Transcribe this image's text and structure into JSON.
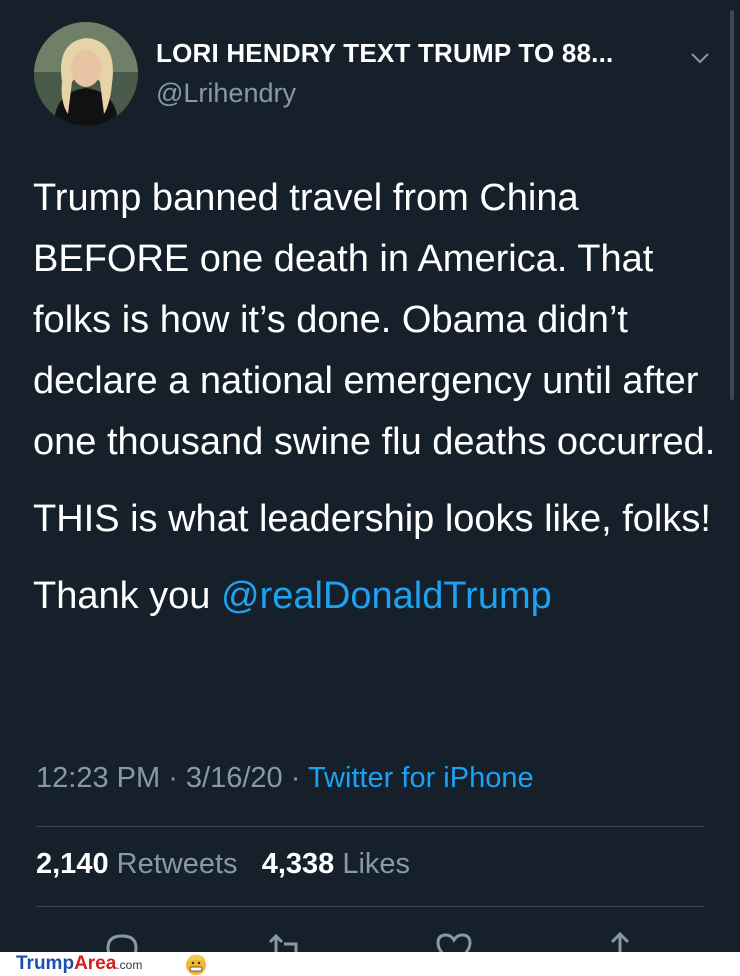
{
  "author": {
    "display_name": "LORI HENDRY TEXT TRUMP TO 88...",
    "handle": "@Lrihendry"
  },
  "tweet": {
    "paragraph1": "Trump banned travel from China BEFORE one death in America. That folks is how it’s done. Obama didn’t declare a national emergency until after one thousand swine flu deaths occurred.",
    "paragraph2": "THIS is what leadership looks like, folks!",
    "paragraph3_prefix": "Thank you ",
    "mention": "@realDonaldTrump"
  },
  "meta": {
    "time": "12:23 PM",
    "separator": " · ",
    "date": "3/16/20",
    "source": "Twitter for iPhone"
  },
  "stats": {
    "retweets_count": "2,140",
    "retweets_label": "Retweets",
    "likes_count": "4,338",
    "likes_label": "Likes"
  },
  "icons": {
    "reply": "reply-icon",
    "retweet": "retweet-icon",
    "like": "like-icon",
    "share": "share-icon",
    "menu": "chevron-down-icon"
  },
  "colors": {
    "background": "#15202b",
    "secondary_text": "#8899a6",
    "link": "#1da1f2",
    "divider": "#38444d"
  },
  "watermark": {
    "part1": "Trump",
    "part2": "Area",
    "part3": ".com"
  }
}
